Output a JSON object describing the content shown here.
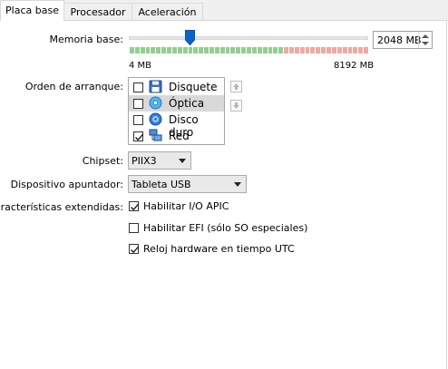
{
  "tabs": [
    {
      "label": "Placa base",
      "active": true
    },
    {
      "label": "Procesador",
      "active": false
    },
    {
      "label": "Aceleración",
      "active": false
    }
  ],
  "memory": {
    "label": "Memoria base:",
    "value": "2048 MB",
    "min_label": "4 MB",
    "max_label": "8192 MB",
    "fraction": 0.25
  },
  "boot_order": {
    "label": "Orden de arranque:",
    "items": [
      {
        "label": "Disquete",
        "checked": false,
        "icon": "floppy-icon"
      },
      {
        "label": "Óptica",
        "checked": false,
        "icon": "optical-disc-icon",
        "selected": true
      },
      {
        "label": "Disco duro",
        "checked": false,
        "icon": "hard-disk-icon"
      },
      {
        "label": "Red",
        "checked": true,
        "icon": "network-icon"
      }
    ]
  },
  "chipset": {
    "label": "Chipset:",
    "value": "PIIX3"
  },
  "pointing_device": {
    "label": "Dispositivo apuntador:",
    "value": "Tableta USB"
  },
  "extended": {
    "label": "Características extendidas:",
    "options": [
      {
        "label": "Habilitar I/O APIC",
        "checked": true
      },
      {
        "label": "Habilitar EFI (sólo SO especiales)",
        "checked": false
      },
      {
        "label": "Reloj hardware en tiempo UTC",
        "checked": true
      }
    ]
  },
  "colors": {
    "accent": "#0a64c8",
    "good_zone": "#8fd18f",
    "bad_zone": "#f0a8a0"
  }
}
